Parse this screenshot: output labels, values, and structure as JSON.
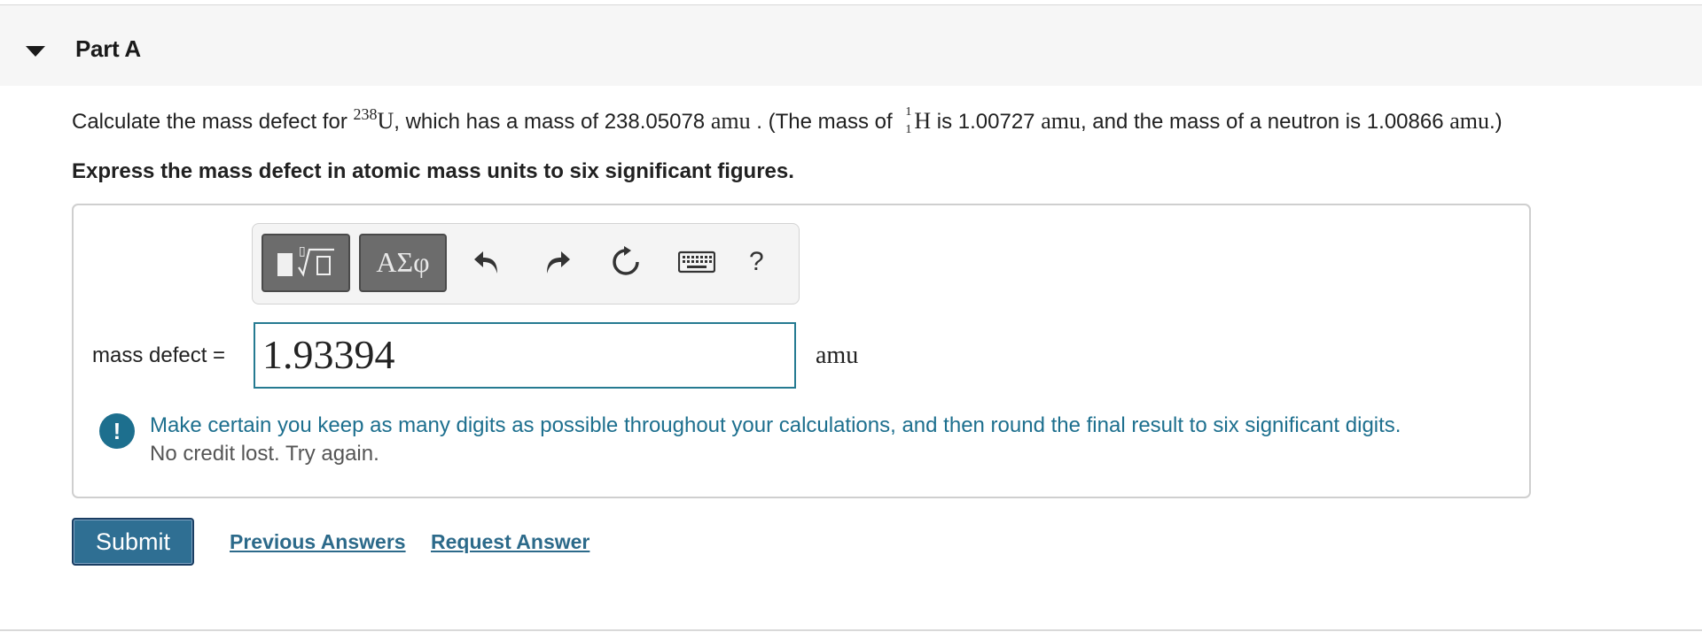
{
  "part": {
    "title": "Part A"
  },
  "question": {
    "text1": "Calculate the mass defect for ",
    "isotope_mass_number": "238",
    "isotope_symbol": "U",
    "text2": ", which has a mass of 238.05078 ",
    "unit1": "amu",
    "text3": " . (The mass of ",
    "nuclide_mass_number": "1",
    "nuclide_atomic_number": "1",
    "nuclide_symbol": "H",
    "text4": " is 1.00727 ",
    "unit2": "amu",
    "text5": ", and the mass of a neutron is 1.00866 ",
    "unit3": "amu",
    "text6": ".)"
  },
  "instruction": "Express the mass defect in atomic mass units to six significant figures.",
  "toolbar": {
    "greek_label": "ΑΣφ",
    "help_label": "?",
    "icons": [
      "templates-icon",
      "undo-icon",
      "redo-icon",
      "reset-icon",
      "keyboard-icon",
      "help-icon"
    ]
  },
  "answer": {
    "label": "mass defect =",
    "value": "1.93394",
    "unit": "amu"
  },
  "feedback": {
    "icon": "!",
    "message": "Make certain you keep as many digits as possible throughout your calculations, and then round the final result to six significant digits.",
    "status": "No credit lost. Try again."
  },
  "actions": {
    "submit": "Submit",
    "previous_answers": "Previous Answers",
    "request_answer": "Request Answer"
  },
  "colors": {
    "accent": "#1d6f8e",
    "submit_bg": "#2f6f93",
    "header_bg": "#f6f6f6",
    "toolbar_button": "#6c6c6c"
  }
}
